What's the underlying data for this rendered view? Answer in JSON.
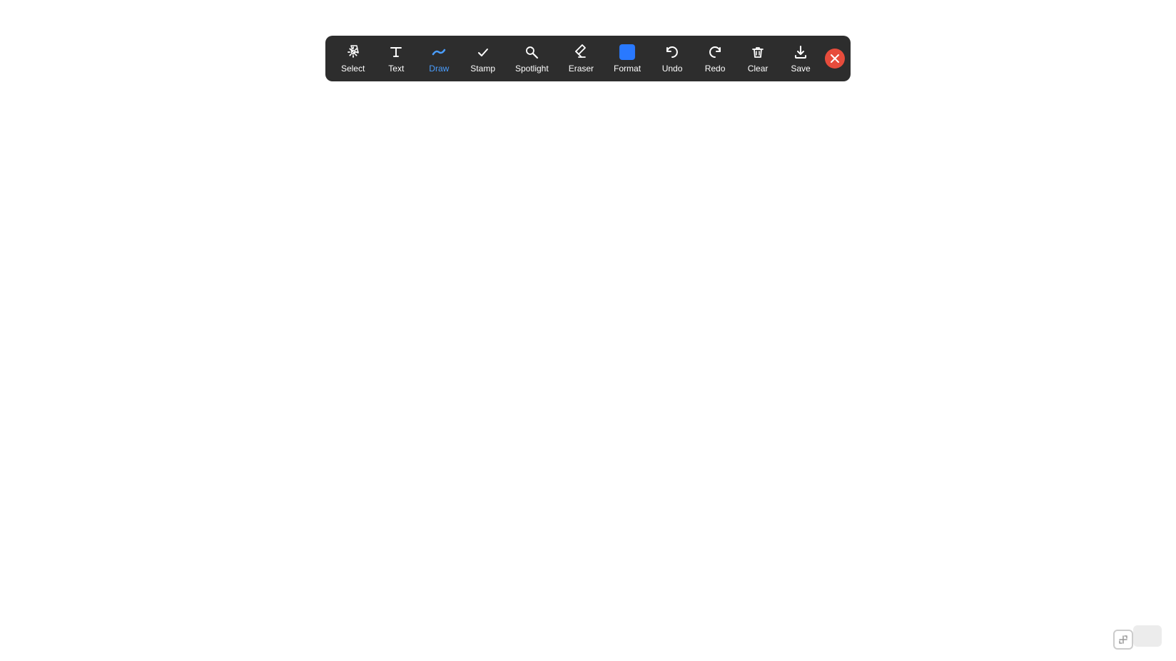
{
  "toolbar": {
    "items": [
      {
        "id": "select",
        "label": "Select",
        "icon": "move",
        "active": false
      },
      {
        "id": "text",
        "label": "Text",
        "icon": "text",
        "active": false
      },
      {
        "id": "draw",
        "label": "Draw",
        "icon": "wave",
        "active": true,
        "activeColor": "#4a9eff"
      },
      {
        "id": "stamp",
        "label": "Stamp",
        "icon": "check",
        "active": false
      },
      {
        "id": "spotlight",
        "label": "Spotlight",
        "icon": "spotlight",
        "active": false
      },
      {
        "id": "eraser",
        "label": "Eraser",
        "icon": "eraser",
        "active": false
      },
      {
        "id": "format",
        "label": "Format",
        "icon": "square",
        "active": true
      },
      {
        "id": "undo",
        "label": "Undo",
        "icon": "undo",
        "active": false
      },
      {
        "id": "redo",
        "label": "Redo",
        "icon": "redo",
        "active": false
      },
      {
        "id": "clear",
        "label": "Clear",
        "icon": "trash",
        "active": false
      },
      {
        "id": "save",
        "label": "Save",
        "icon": "save",
        "active": false
      }
    ],
    "closeButton": "×"
  }
}
